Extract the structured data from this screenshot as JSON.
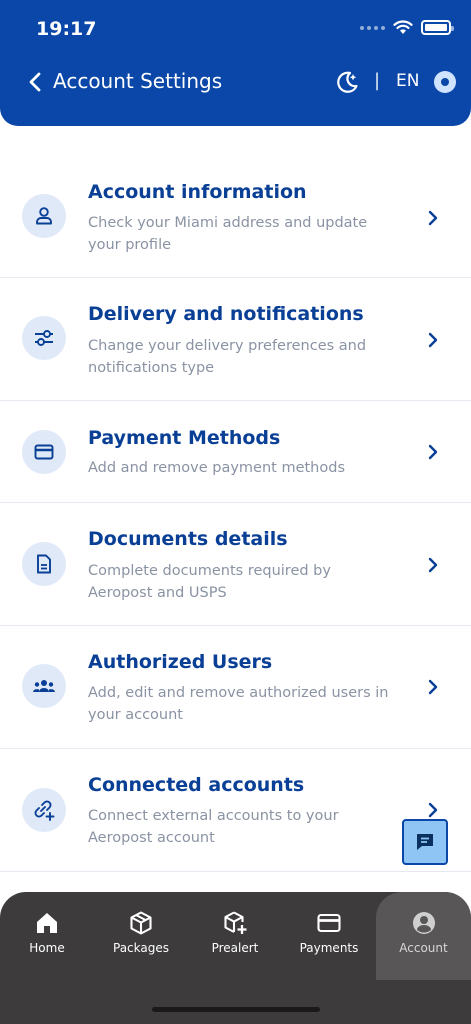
{
  "status_bar": {
    "time": "19:17"
  },
  "header": {
    "title": "Account Settings",
    "separator": "|",
    "language": "EN"
  },
  "settings": [
    {
      "title": "Account information",
      "description": "Check your Miami address and update your profile",
      "icon": "user-icon"
    },
    {
      "title": "Delivery and notifications",
      "description": "Change your delivery preferences and notifications type",
      "icon": "sliders-icon"
    },
    {
      "title": "Payment Methods",
      "description": "Add and remove payment methods",
      "icon": "credit-card-icon"
    },
    {
      "title": "Documents details",
      "description": "Complete documents required by Aeropost and USPS",
      "icon": "document-icon"
    },
    {
      "title": "Authorized Users",
      "description": "Add, edit and remove authorized users in your account",
      "icon": "users-icon"
    },
    {
      "title": "Connected accounts",
      "description": "Connect external accounts to your Aeropost account",
      "icon": "link-add-icon"
    }
  ],
  "tabs": [
    {
      "label": "Home",
      "icon": "home-icon"
    },
    {
      "label": "Packages",
      "icon": "package-icon"
    },
    {
      "label": "Prealert",
      "icon": "package-add-icon"
    },
    {
      "label": "Payments",
      "icon": "card-icon"
    },
    {
      "label": "Account",
      "icon": "account-circle-icon",
      "active": true
    }
  ],
  "colors": {
    "brand_blue": "#0a47a8",
    "title_blue": "#0a3f96",
    "icon_bg": "#dfe9f8",
    "tab_bar": "#3d3b3b",
    "tab_active": "#585656",
    "chat_fab": "#8ec5f5"
  }
}
